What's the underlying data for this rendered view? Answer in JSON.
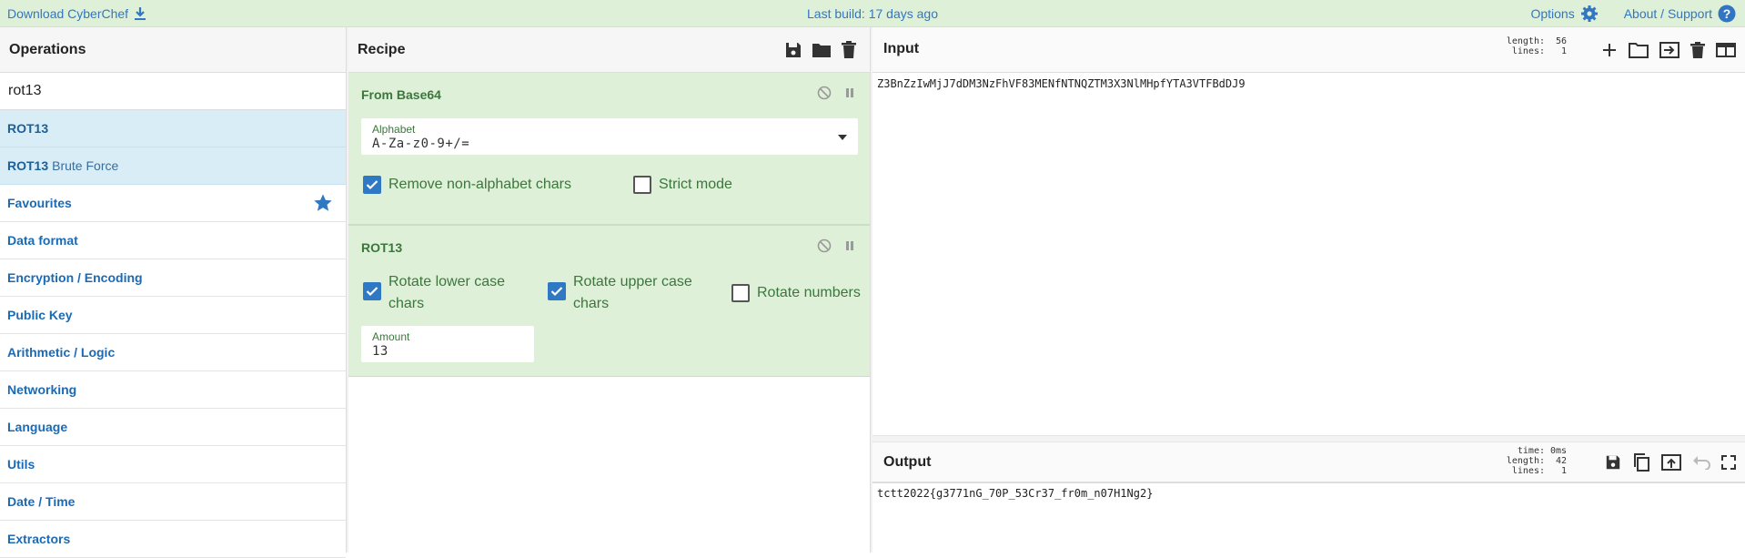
{
  "topbar": {
    "download_label": "Download CyberChef",
    "build_label": "Last build: 17 days ago",
    "options_label": "Options",
    "about_label": "About / Support"
  },
  "operations": {
    "title": "Operations",
    "search_value": "rot13",
    "results": [
      {
        "main": "ROT13",
        "sub": ""
      },
      {
        "main": "ROT13",
        "sub": "Brute Force"
      }
    ],
    "categories": [
      "Favourites",
      "Data format",
      "Encryption / Encoding",
      "Public Key",
      "Arithmetic / Logic",
      "Networking",
      "Language",
      "Utils",
      "Date / Time",
      "Extractors"
    ]
  },
  "recipe": {
    "title": "Recipe",
    "from_base64": {
      "title": "From Base64",
      "alphabet_label": "Alphabet",
      "alphabet_value": "A-Za-z0-9+/=",
      "remove_non_alpha": {
        "label": "Remove non-alphabet chars",
        "checked": true
      },
      "strict_mode": {
        "label": "Strict mode",
        "checked": false
      }
    },
    "rot13": {
      "title": "ROT13",
      "rotate_lower_1": "Rotate lower case",
      "rotate_lower_2": "chars",
      "rotate_upper_1": "Rotate upper case",
      "rotate_upper_2": "chars",
      "rotate_numbers": "Rotate numbers",
      "amount_label": "Amount",
      "amount_value": "13"
    }
  },
  "input": {
    "title": "Input",
    "length_key": "length:",
    "length_val": "56",
    "lines_key": "lines:",
    "lines_val": "1",
    "text": "Z3BnZzIwMjJ7dDM3NzFhVF83MENfNTNQZTM3X3NlMHpfYTA3VTFBdDJ9"
  },
  "output": {
    "title": "Output",
    "time_key": "time:",
    "time_val": "0ms",
    "length_key": "length:",
    "length_val": "42",
    "lines_key": "lines:",
    "lines_val": "1",
    "text": "tctt2022{g3771nG_70P_53Cr37_fr0m_n07H1Ng2}"
  },
  "colors": {
    "accent": "#3276c3",
    "recipe_bg": "#dff0d8",
    "highlight": "#d9edf7"
  }
}
